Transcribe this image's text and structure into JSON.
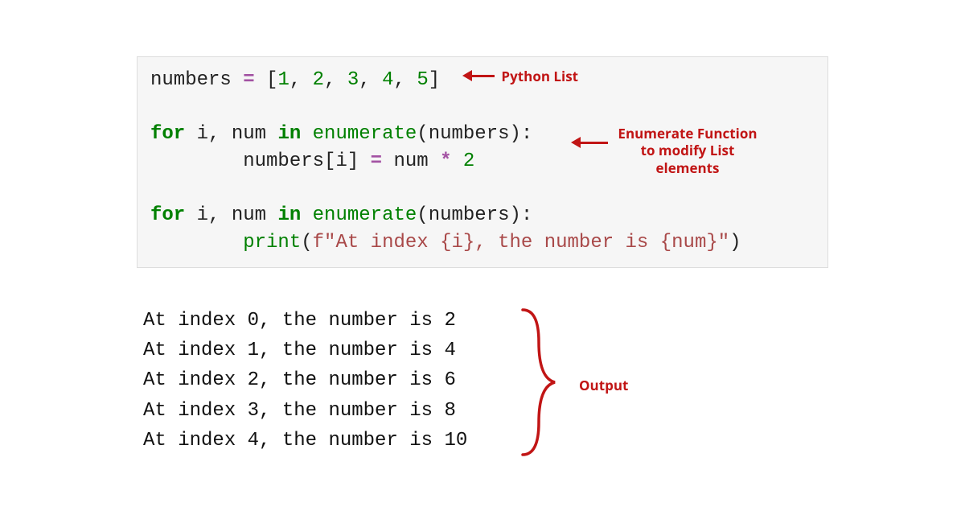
{
  "code": {
    "line1": {
      "var": "numbers ",
      "assign": "=",
      "space": " ",
      "open": "[",
      "n1": "1",
      "c1": ", ",
      "n2": "2",
      "c2": ", ",
      "n3": "3",
      "c3": ", ",
      "n4": "4",
      "c4": ", ",
      "n5": "5",
      "close": "]"
    },
    "line2": {
      "for": "for",
      "vars": " i, num ",
      "in": "in",
      "sp": " ",
      "fn": "enumerate",
      "open": "(",
      "arg": "numbers",
      "close": "):"
    },
    "line3": {
      "indent": "        ",
      "target": "numbers[i] ",
      "assign": "=",
      "rest1": " num ",
      "mul": "*",
      "sp": " ",
      "two": "2"
    },
    "line4": {
      "for": "for",
      "vars": " i, num ",
      "in": "in",
      "sp": " ",
      "fn": "enumerate",
      "open": "(",
      "arg": "numbers",
      "close": "):"
    },
    "line5": {
      "indent": "        ",
      "print": "print",
      "open": "(",
      "fpref": "f",
      "q1": "\"",
      "s1": "At index ",
      "br1": "{i}",
      "s2": ", the number is ",
      "br2": "{num}",
      "q2": "\"",
      "close": ")"
    }
  },
  "output": [
    "At index 0, the number is 2",
    "At index 1, the number is 4",
    "At index 2, the number is 6",
    "At index 3, the number is 8",
    "At index 4, the number is 10"
  ],
  "annotations": {
    "pythonList": "Python List",
    "enumerate_l1": "Enumerate Function",
    "enumerate_l2": "to modify List",
    "enumerate_l3": "elements",
    "output": "Output"
  }
}
